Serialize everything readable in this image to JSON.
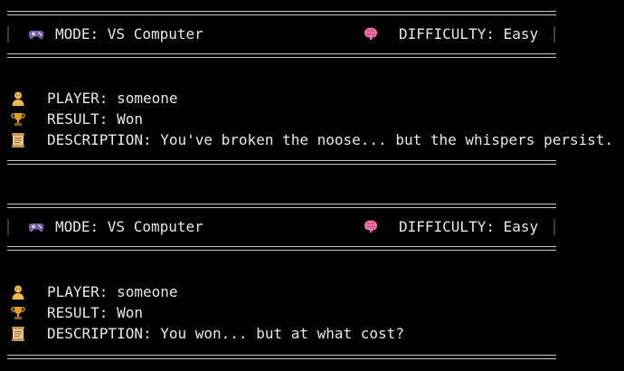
{
  "sessions": [
    {
      "header": {
        "mode_label": "MODE: VS Computer",
        "difficulty_label": "DIFFICULTY: Easy"
      },
      "details": {
        "player_label": "PLAYER: someone",
        "result_label": "RESULT: Won",
        "description_label": "DESCRIPTION: You've broken the noose... but the whispers persist."
      }
    },
    {
      "header": {
        "mode_label": "MODE: VS Computer",
        "difficulty_label": "DIFFICULTY: Easy"
      },
      "details": {
        "player_label": "PLAYER: someone",
        "result_label": "RESULT: Won",
        "description_label": "DESCRIPTION: You won... but at what cost?"
      }
    }
  ],
  "icons": {
    "mode": "gamepad-icon",
    "difficulty": "brain-icon",
    "player": "person-icon",
    "result": "trophy-icon",
    "description": "scroll-icon"
  },
  "colors": {
    "background": "#000000",
    "text": "#e8e8e8",
    "rule": "#c8c8c8",
    "brain": "#f06fa8",
    "gamepad": "#7a5ea8",
    "trophy": "#e0a21a",
    "person": "#f2b84b",
    "scroll": "#e9c48a"
  }
}
